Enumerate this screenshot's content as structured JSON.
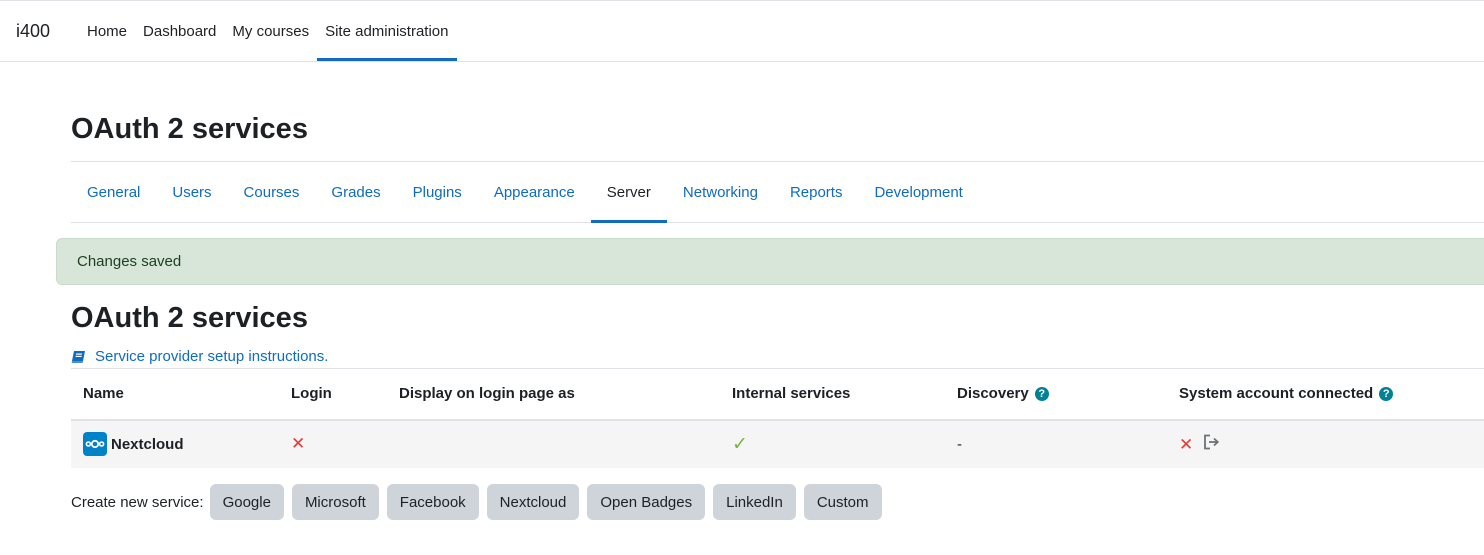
{
  "navbar": {
    "brand": "i400",
    "items": [
      {
        "label": "Home"
      },
      {
        "label": "Dashboard"
      },
      {
        "label": "My courses"
      },
      {
        "label": "Site administration"
      }
    ]
  },
  "page": {
    "title": "OAuth 2 services"
  },
  "tabs": [
    {
      "label": "General"
    },
    {
      "label": "Users"
    },
    {
      "label": "Courses"
    },
    {
      "label": "Grades"
    },
    {
      "label": "Plugins"
    },
    {
      "label": "Appearance"
    },
    {
      "label": "Server"
    },
    {
      "label": "Networking"
    },
    {
      "label": "Reports"
    },
    {
      "label": "Development"
    }
  ],
  "alert": {
    "message": "Changes saved"
  },
  "section": {
    "title": "OAuth 2 services",
    "setup_link": "Service provider setup instructions."
  },
  "table": {
    "headers": {
      "name": "Name",
      "login": "Login",
      "display": "Display on login page as",
      "internal": "Internal services",
      "discovery": "Discovery",
      "system_account": "System account connected"
    },
    "rows": [
      {
        "name": "Nextcloud",
        "display": "",
        "discovery": "-"
      }
    ]
  },
  "create": {
    "label": "Create new service:",
    "buttons": [
      {
        "label": "Google"
      },
      {
        "label": "Microsoft"
      },
      {
        "label": "Facebook"
      },
      {
        "label": "Nextcloud"
      },
      {
        "label": "Open Badges"
      },
      {
        "label": "LinkedIn"
      },
      {
        "label": "Custom"
      }
    ]
  },
  "colors": {
    "link": "#0f6cbf",
    "alert_bg": "#d7e6d9",
    "help_icon": "#008196",
    "error": "#e53935",
    "success": "#7cb342",
    "button_bg": "#ced4da"
  },
  "icons": {
    "setup_link": "book-icon",
    "help": "question-circle-icon",
    "service_logo": "nextcloud-logo-icon",
    "login_status": "cross-icon",
    "internal_status": "check-icon",
    "system_account_status": "cross-icon",
    "connect_action": "sign-in-icon"
  }
}
